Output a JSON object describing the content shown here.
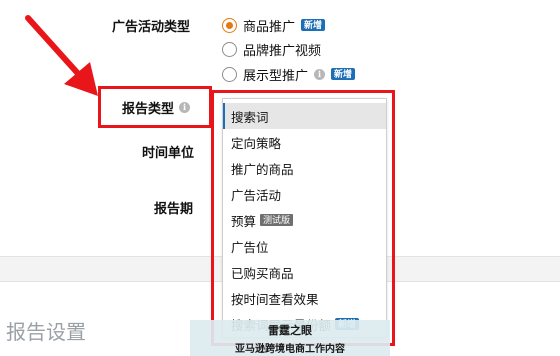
{
  "form": {
    "campaign_type_label": "广告活动类型",
    "campaign_types": [
      {
        "label": "商品推广",
        "checked": true,
        "badge": "新增"
      },
      {
        "label": "品牌推广视频",
        "checked": false,
        "badge": ""
      },
      {
        "label": "展示型推广",
        "checked": false,
        "badge": "新增",
        "info_icon": "info-icon"
      }
    ],
    "report_type_label": "报告类型",
    "time_unit_label": "时间单位",
    "report_period_label": "报告期"
  },
  "dropdown": {
    "items": [
      {
        "label": "搜索词",
        "selected": true,
        "badge": ""
      },
      {
        "label": "定向策略",
        "selected": false,
        "badge": ""
      },
      {
        "label": "推广的商品",
        "selected": false,
        "badge": ""
      },
      {
        "label": "广告活动",
        "selected": false,
        "badge": ""
      },
      {
        "label": "预算",
        "selected": false,
        "badge": "测试版"
      },
      {
        "label": "广告位",
        "selected": false,
        "badge": ""
      },
      {
        "label": "已购买商品",
        "selected": false,
        "badge": ""
      },
      {
        "label": "按时间查看效果",
        "selected": false,
        "badge": ""
      },
      {
        "label": "搜索词展示量份额",
        "selected": false,
        "badge": "新增"
      }
    ]
  },
  "section": {
    "title": "报告设置"
  },
  "watermark": {
    "line1": "雷霆之眼",
    "line2": "亚马逊跨境电商工作内容"
  },
  "colors": {
    "accent_orange": "#e47911",
    "annotation_red": "#e8161b",
    "new_badge_blue": "#1c6fb5"
  }
}
